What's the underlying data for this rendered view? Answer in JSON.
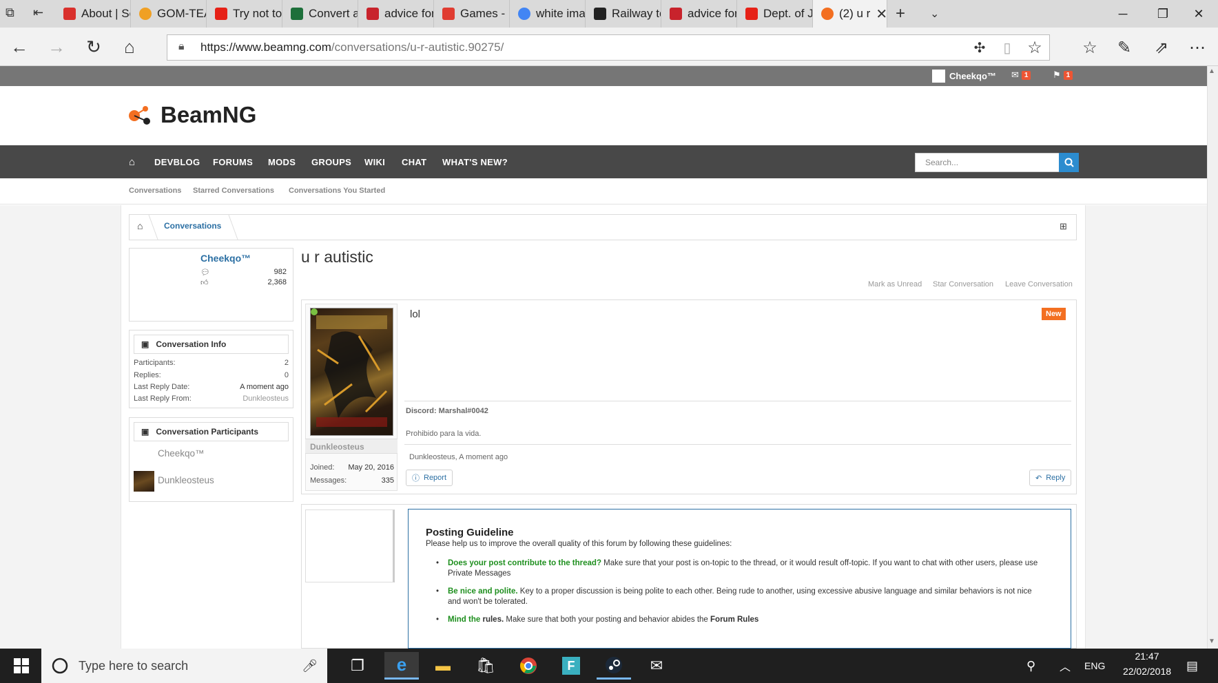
{
  "browser": {
    "tabs": [
      {
        "label": "About | Sc",
        "color": "#d9302c"
      },
      {
        "label": "GOM-TEA",
        "color": "#f0a024"
      },
      {
        "label": "Try not to",
        "color": "#e62117"
      },
      {
        "label": "Convert ar",
        "color": "#1d6f3a"
      },
      {
        "label": "advice for",
        "color": "#c8232c"
      },
      {
        "label": "Games - R",
        "color": "#e03c31"
      },
      {
        "label": "white imag",
        "color": "#4285f4"
      },
      {
        "label": "Railway to",
        "color": "#222222"
      },
      {
        "label": "advice for",
        "color": "#c8232c"
      },
      {
        "label": "Dept. of Ju",
        "color": "#e62117"
      },
      {
        "label": "(2) u r",
        "color": "#f36f21"
      }
    ],
    "tab_close": "✕",
    "new_tab": "+",
    "url_host": "https://www.beamng.com",
    "url_path": "/conversations/u-r-autistic.90275/"
  },
  "forum": {
    "username": "Cheekqo™",
    "inbox_count": "1",
    "alerts_count": "1",
    "logo_text": "BeamNG",
    "nav": [
      "DEVBLOG",
      "FORUMS",
      "MODS",
      "GROUPS",
      "WIKI",
      "CHAT",
      "WHAT'S NEW?"
    ],
    "search_placeholder": "Search...",
    "subnav": [
      "Conversations",
      "Starred Conversations",
      "Conversations You Started"
    ],
    "breadcrumb": "Conversations",
    "profile": {
      "name": "Cheekqo™",
      "messages": "982",
      "likes": "2,368"
    },
    "conv_info": {
      "title": "Conversation Info",
      "rows": [
        {
          "k": "Participants:",
          "v": "2"
        },
        {
          "k": "Replies:",
          "v": "0"
        },
        {
          "k": "Last Reply Date:",
          "v": "A moment ago"
        },
        {
          "k": "Last Reply From:",
          "v": "Dunkleosteus"
        }
      ]
    },
    "participants": {
      "title": "Conversation Participants",
      "names": [
        "Cheekqo™",
        "Dunkleosteus"
      ]
    },
    "thread_title": "u r autistic",
    "actions": [
      "Mark as Unread",
      "Star Conversation",
      "Leave Conversation"
    ],
    "post": {
      "text": "lol",
      "new_badge": "New",
      "author": "Dunkleosteus",
      "joined_label": "Joined:",
      "joined": "May 20, 2016",
      "messages_label": "Messages:",
      "messages": "335",
      "sig1": "Discord: Marshal#0042",
      "sig2": "Prohibido para la vida.",
      "meta": "Dunkleosteus, A moment ago",
      "report": "Report",
      "reply": "Reply"
    },
    "guideline": {
      "title": "Posting Guideline",
      "intro": "Please help us to improve the overall quality of this forum by following these guidelines:",
      "b1_bold": "Does your post contribute to the thread?",
      "b1_text": " Make sure that your post is on-topic to the thread, or it would result off-topic. If you want to chat with other users, please use Private Messages",
      "b2_bold": "Be nice and polite.",
      "b2_text": " Key to a proper discussion is being polite to each other. Being rude to another, using excessive abusive language and similar behaviors is not nice and won't be tolerated.",
      "b3_bold": "Mind the",
      "b3_bold2": "rules.",
      "b3_text": " Make sure that both your posting and behavior abides the ",
      "b3_link": "Forum Rules"
    }
  },
  "taskbar": {
    "search_placeholder": "Type here to search",
    "lang": "ENG",
    "time": "21:47",
    "date": "22/02/2018"
  }
}
